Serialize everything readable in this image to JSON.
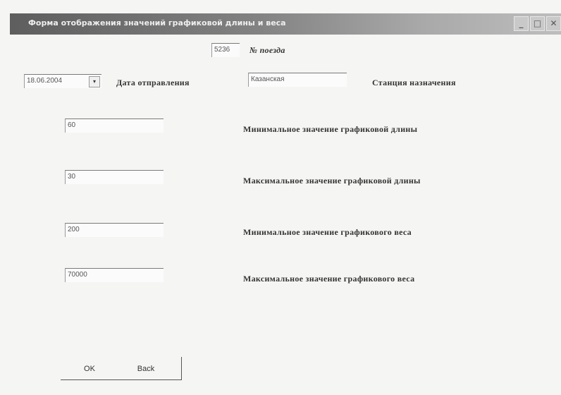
{
  "window": {
    "title": "Форма отображения значений графиковой длины и веса",
    "controls": {
      "minimize": "_",
      "maximize": "□",
      "close": "✕"
    }
  },
  "train": {
    "value": "5236",
    "label": "№ поезда"
  },
  "departure": {
    "date_value": "18.06.2004",
    "dropdown_icon": "▾",
    "label": "Дата отправления"
  },
  "destination": {
    "value": "Казанская",
    "label": "Станция назначения"
  },
  "params": [
    {
      "value": "60",
      "label": "Минимальное значение графиковой длины"
    },
    {
      "value": "30",
      "label": "Максимальное значение графиковой длины"
    },
    {
      "value": "200",
      "label": "Минимальное значение графикового веса"
    },
    {
      "value": "70000",
      "label": "Максимальное значение графикового веса"
    }
  ],
  "buttons": {
    "ok": "OK",
    "back": "Back"
  }
}
